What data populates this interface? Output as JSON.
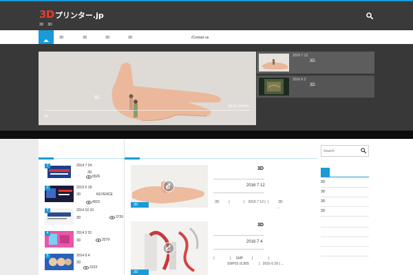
{
  "header": {
    "logo_3d": "3D",
    "logo_text": "プリンター.jp",
    "tagline_1": "3D",
    "tagline_2": "3D"
  },
  "nav": {
    "items": [
      "3D",
      "3D",
      "3D",
      "3D",
      "/Contact us"
    ]
  },
  "hero": {
    "caption": "3D",
    "sub": "3D",
    "more": "READ MORE",
    "side_cards": [
      {
        "date": "2016 7 12",
        "title": "3D"
      },
      {
        "date": "2016 6 2",
        "title": "3D"
      }
    ]
  },
  "ranking": [
    {
      "num": "1",
      "date": "2014 7 24",
      "t1": "3D",
      "t2": "",
      "views": "6526"
    },
    {
      "num": "2",
      "date": "2015 5 18",
      "t1": "3D",
      "t2": "KEYENCE",
      "views": "4915"
    },
    {
      "num": "3",
      "date": "2014 10 10",
      "t1": "3D",
      "t2": "",
      "views": "3720"
    },
    {
      "num": "4",
      "date": "2014 3 31",
      "t1": "3D",
      "t2": "",
      "views": "3279"
    },
    {
      "num": "5",
      "date": "2014 9 4",
      "t1": "3D",
      "t2": "",
      "views": "3133"
    }
  ],
  "posts": [
    {
      "badge": "3D",
      "title": "3D",
      "date": "2016 7 12",
      "excerpt_1": "3D          (              )    2016 7 12 (  )          3D",
      "excerpt_2": "..."
    },
    {
      "badge": "3D",
      "title": "3D",
      "date": "2016 7 4",
      "excerpt_1": "(                )     SMP         (                )",
      "excerpt_2": "SMP55 (6,805          )   2016 6 29 ( ..."
    }
  ],
  "sidebar": {
    "search_placeholder": "Search",
    "categories": [
      "3D",
      "3D",
      "3D",
      "3D"
    ]
  },
  "colors": {
    "accent": "#1a9ad7",
    "logo_red": "#e83a2e",
    "header_bg": "#3a3a3a"
  }
}
